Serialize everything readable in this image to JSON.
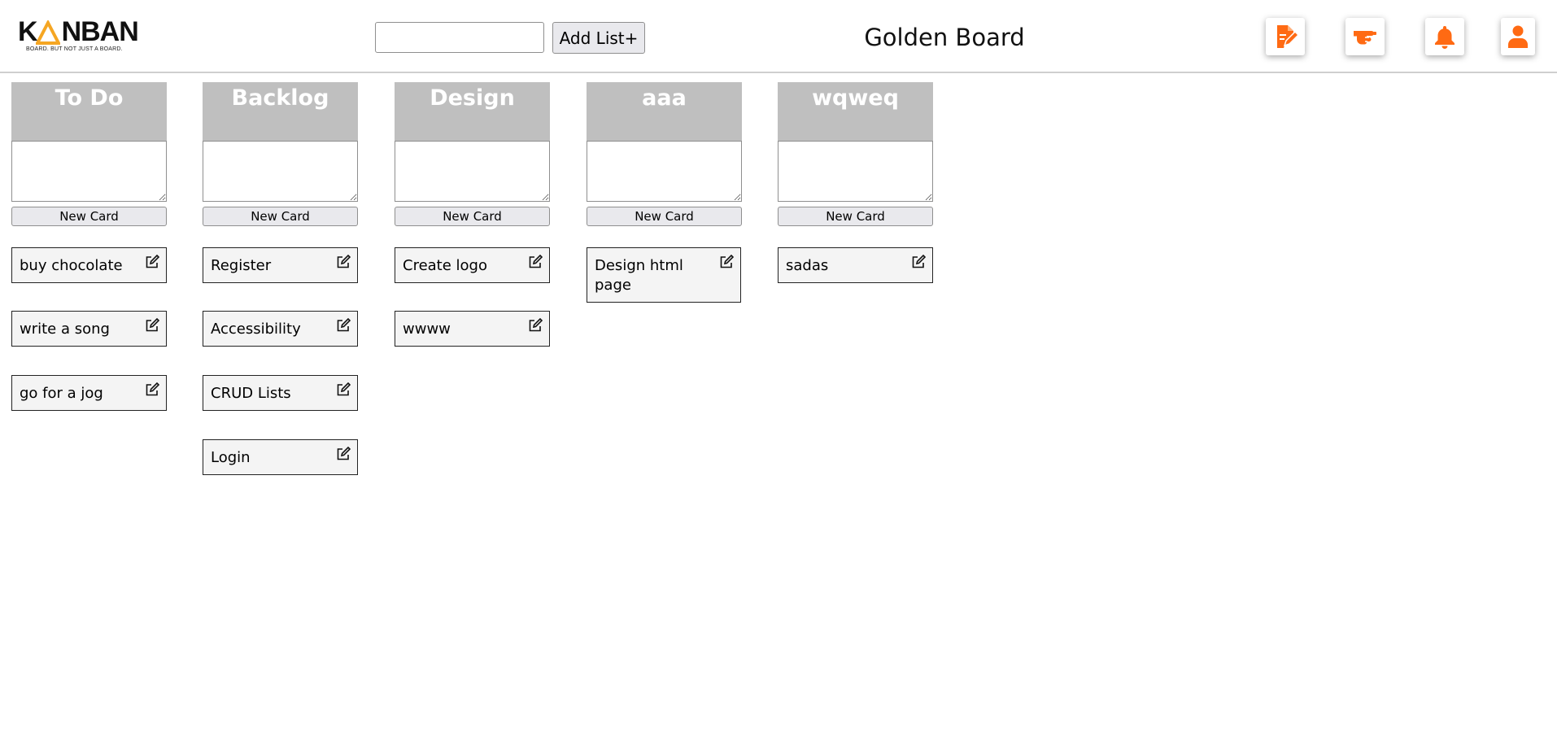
{
  "header": {
    "logo": {
      "word_left": "K",
      "word_right": "NBAN",
      "tagline": "BOARD. BUT NOT JUST A BOARD."
    },
    "add_list_input": {
      "value": "",
      "placeholder": ""
    },
    "add_list_label": "Add List+",
    "board_title": "Golden Board",
    "icons": [
      {
        "name": "edit-document-icon"
      },
      {
        "name": "pointing-hand-icon"
      },
      {
        "name": "bell-icon"
      },
      {
        "name": "user-icon"
      }
    ]
  },
  "colors": {
    "accent": "#ff6a13",
    "list_header_bg": "#bfbfbf",
    "card_bg": "#f4f4f4",
    "logo_triangle": "#f5a623"
  },
  "lists": [
    {
      "title": "To Do",
      "textarea_value": "",
      "new_card_label": "New Card",
      "cards": [
        "buy chocolate",
        "write a song",
        "go for a jog"
      ]
    },
    {
      "title": "Backlog",
      "textarea_value": "",
      "new_card_label": "New Card",
      "cards": [
        "Register",
        "Accessibility",
        "CRUD Lists",
        "Login"
      ]
    },
    {
      "title": "Design",
      "textarea_value": "",
      "new_card_label": "New Card",
      "cards": [
        "Create logo",
        "wwww"
      ]
    },
    {
      "title": "aaa",
      "textarea_value": "",
      "new_card_label": "New Card",
      "cards": [
        "Design html page"
      ]
    },
    {
      "title": "wqweq",
      "textarea_value": "",
      "new_card_label": "New Card",
      "cards": [
        "sadas"
      ]
    }
  ]
}
